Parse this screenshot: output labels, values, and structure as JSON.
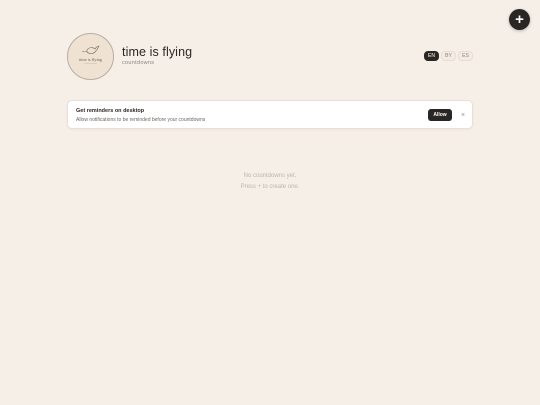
{
  "fab": {
    "label": "+"
  },
  "header": {
    "logo_text": "time is flying",
    "title": "time is flying",
    "subtitle": "countdowns"
  },
  "languages": [
    {
      "code": "EN",
      "active": true
    },
    {
      "code": "BY",
      "active": false
    },
    {
      "code": "ES",
      "active": false
    }
  ],
  "notice": {
    "title": "Get reminders on desktop",
    "text": "Allow notifications to be reminded before your countdowns",
    "allow_label": "Allow",
    "close_label": "×"
  },
  "empty_state": {
    "line1": "No countdowns yet.",
    "line2": "Press + to create one."
  },
  "colors": {
    "background": "#f6efe7",
    "accent_dark": "#2a2623",
    "card": "#ffffff"
  }
}
